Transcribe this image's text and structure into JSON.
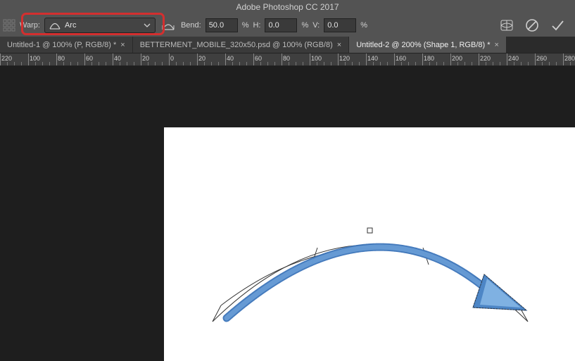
{
  "app_title": "Adobe Photoshop CC 2017",
  "options": {
    "warp_label": "Warp:",
    "warp_value": "Arc",
    "bend_label": "Bend:",
    "bend_value": "50.0",
    "h_label": "H:",
    "h_value": "0.0",
    "v_label": "V:",
    "v_value": "0.0",
    "pct": "%"
  },
  "tabs": [
    {
      "label": "Untitled-1 @ 100% (P, RGB/8) *",
      "active": false,
      "close": "×"
    },
    {
      "label": "BETTERMENT_MOBILE_320x50.psd @ 100% (RGB/8)",
      "active": false,
      "close": "×"
    },
    {
      "label": "Untitled-2 @ 200% (Shape 1, RGB/8) *",
      "active": true,
      "close": "×"
    }
  ],
  "ruler": {
    "labels": [
      "220",
      "100",
      "80",
      "60",
      "40",
      "20",
      "0",
      "20",
      "40",
      "60",
      "80",
      "100",
      "120",
      "140",
      "160",
      "180",
      "200",
      "220",
      "240",
      "260",
      "280"
    ]
  }
}
